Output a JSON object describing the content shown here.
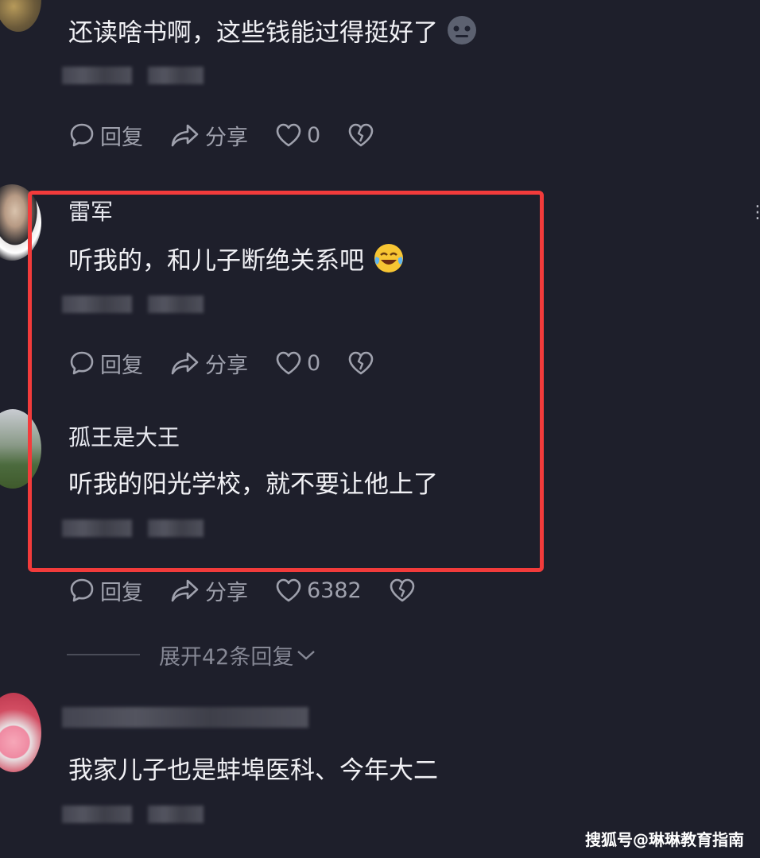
{
  "comments": [
    {
      "username": "",
      "text": "还读啥书啊，这些钱能过得挺好了",
      "emoji": "robot-emoji",
      "actions": {
        "reply": "回复",
        "share": "分享",
        "likes": "0"
      }
    },
    {
      "username": "雷军",
      "text": "听我的，和儿子断绝关系吧",
      "emoji": "laugh-cry-emoji",
      "actions": {
        "reply": "回复",
        "share": "分享",
        "likes": "0"
      }
    },
    {
      "username": "孤王是大王",
      "text": "听我的阳光学校，就不要让他上了",
      "actions": {
        "reply": "回复",
        "share": "分享",
        "likes": "6382"
      }
    },
    {
      "username": "",
      "text": "我家儿子也是蚌埠医科、今年大二"
    }
  ],
  "expand_replies": "展开42条回复",
  "watermark": "搜狐号@琳琳教育指南",
  "colors": {
    "background": "#1e1f2b",
    "highlight_border": "#f23b3b",
    "action_text": "#9fa1ad"
  },
  "icons": [
    "comment-bubble-icon",
    "share-arrow-icon",
    "heart-icon",
    "broken-heart-icon",
    "chevron-down-icon",
    "more-dots-icon"
  ]
}
